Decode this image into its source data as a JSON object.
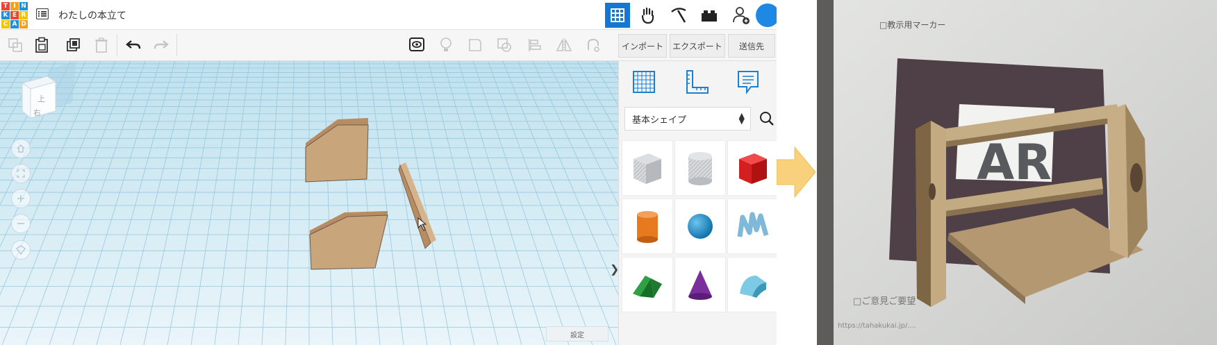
{
  "app": {
    "logo_letters": [
      "T",
      "I",
      "N",
      "K",
      "E",
      "R",
      "C",
      "A",
      "D"
    ],
    "design_title": "わたしの本立て"
  },
  "header_icons": [
    "grid-view-icon",
    "hand-paw-icon",
    "pickaxe-icon",
    "brick-icon",
    "add-user-icon",
    "avatar"
  ],
  "toolbar": {
    "import_label": "インポート",
    "export_label": "エクスポート",
    "send_label": "送信先"
  },
  "workplane": {
    "settings_label": "設定",
    "viewcube_faces": [
      "上",
      "右"
    ]
  },
  "panel": {
    "category": "基本シェイプ",
    "shapes": [
      "box-hole",
      "cylinder-hole",
      "box",
      "cylinder",
      "sphere",
      "text",
      "roof",
      "cone",
      "round-roof"
    ]
  },
  "colors": {
    "accent": "#1477d2",
    "workplane_grid": "#9ccbe0",
    "part_color": "#c9a57c",
    "arrow": "#f9d07b"
  },
  "photo": {
    "marker_caption": "□教示用マーカー",
    "marker_text": "AR",
    "bottom_text": "□ご意見ご要望",
    "url_text": "https://tahakukai.jp/...."
  }
}
